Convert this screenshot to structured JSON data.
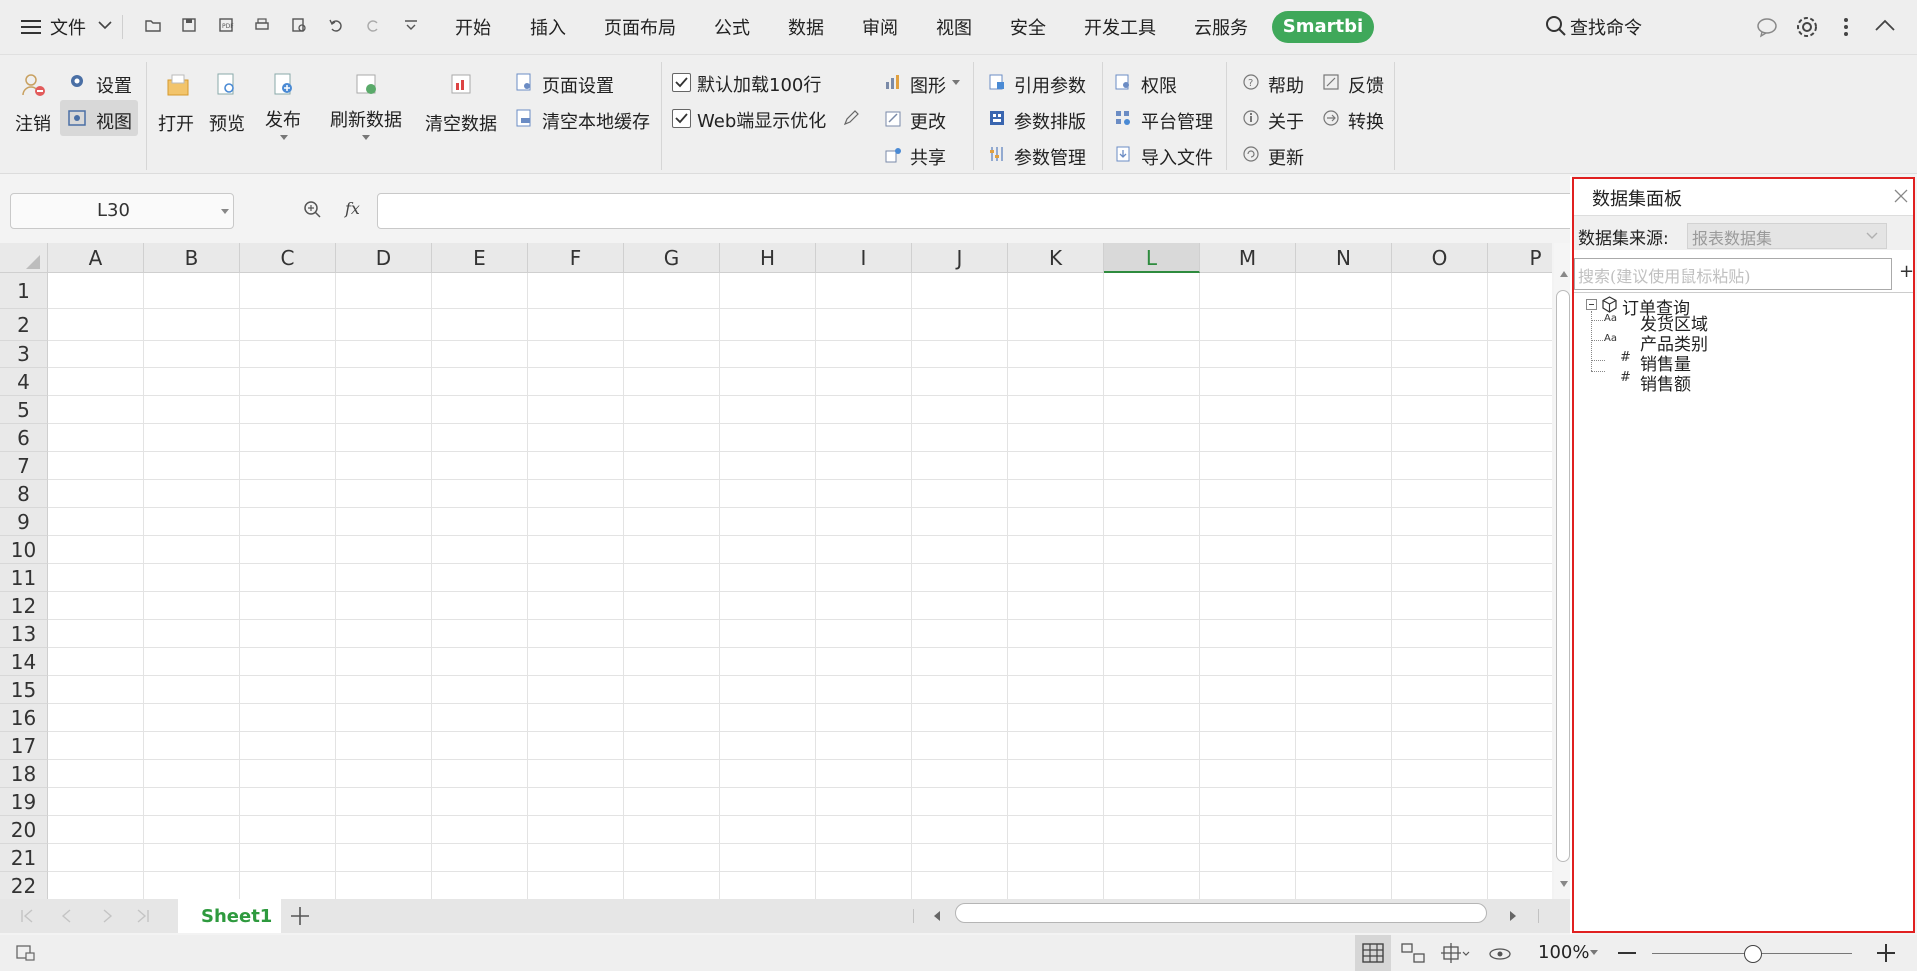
{
  "menubar": {
    "menu_label": "文件",
    "tabs": [
      "开始",
      "插入",
      "页面布局",
      "公式",
      "数据",
      "审阅",
      "视图",
      "安全",
      "开发工具",
      "云服务"
    ],
    "smartbi": "Smartbi",
    "search": "查找命令"
  },
  "ribbon": {
    "logout": "注销",
    "settings": "设置",
    "view": "视图",
    "open": "打开",
    "preview": "预览",
    "publish": "发布",
    "refresh": "刷新数据",
    "clear": "清空数据",
    "page_setup": "页面设置",
    "clear_cache": "清空本地缓存",
    "default_load": "默认加载100行",
    "web_optimize": "Web端显示优化",
    "chart": "图形",
    "change": "更改",
    "share": "共享",
    "ref_param": "引用参数",
    "param_layout": "参数排版",
    "param_manage": "参数管理",
    "permission": "权限",
    "platform": "平台管理",
    "import": "导入文件",
    "help": "帮助",
    "about": "关于",
    "update": "更新",
    "feedback": "反馈",
    "convert": "转换"
  },
  "formula": {
    "cell_ref": "L30",
    "fx": "fx"
  },
  "grid": {
    "columns": [
      "A",
      "B",
      "C",
      "D",
      "E",
      "F",
      "G",
      "H",
      "I",
      "J",
      "K",
      "L",
      "M",
      "N",
      "O",
      "P"
    ],
    "rows": [
      "1",
      "2",
      "3",
      "4",
      "5",
      "6",
      "7",
      "8",
      "9",
      "10",
      "11",
      "12",
      "13",
      "14",
      "15",
      "16",
      "17",
      "18",
      "19",
      "20",
      "21",
      "22"
    ],
    "active_column": "L"
  },
  "sheets": {
    "tabs": [
      "Sheet1"
    ]
  },
  "status": {
    "zoom": "100%"
  },
  "panel": {
    "title": "数据集面板",
    "source_label": "数据集来源:",
    "source_value": "报表数据集",
    "search_placeholder": "搜索(建议使用鼠标粘贴)",
    "add": "+",
    "tree_root": "订单查询",
    "fields": [
      {
        "type": "text",
        "name": "发货区域"
      },
      {
        "type": "text",
        "name": "产品类别"
      },
      {
        "type": "number",
        "name": "销售量"
      },
      {
        "type": "number",
        "name": "销售额"
      }
    ]
  },
  "colors": {
    "accent_green": "#3fa85a",
    "panel_border": "#e02020",
    "active_col": "#2e8b3e"
  }
}
